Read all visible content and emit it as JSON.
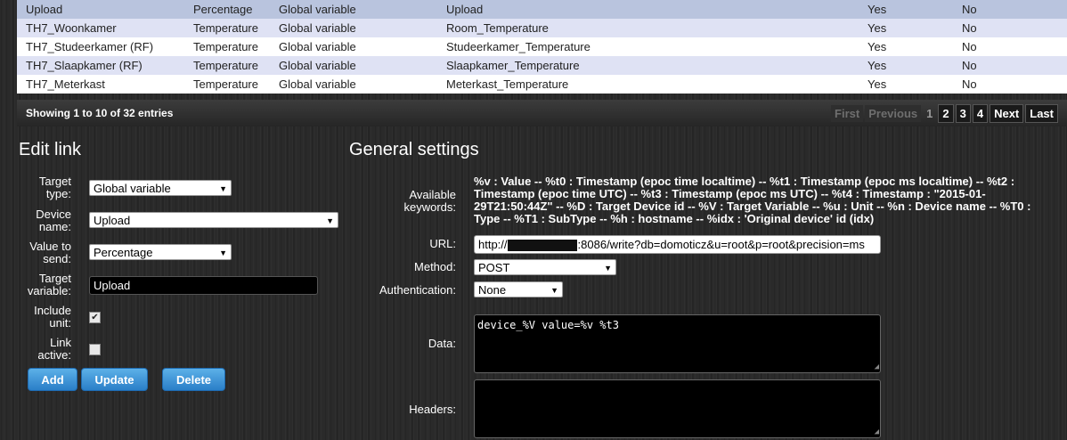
{
  "table": {
    "partial_row": [
      "",
      "",
      ""
    ],
    "rows": [
      {
        "name": "Upload",
        "type": "Percentage",
        "target": "Global variable",
        "variable": "Upload",
        "include_unit": "Yes",
        "active": "No",
        "style": "selected"
      },
      {
        "name": "TH7_Woonkamer",
        "type": "Temperature",
        "target": "Global variable",
        "variable": "Room_Temperature",
        "include_unit": "Yes",
        "active": "No",
        "style": "odd"
      },
      {
        "name": "TH7_Studeerkamer (RF)",
        "type": "Temperature",
        "target": "Global variable",
        "variable": "Studeerkamer_Temperature",
        "include_unit": "Yes",
        "active": "No",
        "style": "even"
      },
      {
        "name": "TH7_Slaapkamer (RF)",
        "type": "Temperature",
        "target": "Global variable",
        "variable": "Slaapkamer_Temperature",
        "include_unit": "Yes",
        "active": "No",
        "style": "odd"
      },
      {
        "name": "TH7_Meterkast",
        "type": "Temperature",
        "target": "Global variable",
        "variable": "Meterkast_Temperature",
        "include_unit": "Yes",
        "active": "No",
        "style": "even"
      }
    ],
    "info": "Showing 1 to 10 of 32 entries",
    "paging": {
      "first": "First",
      "previous": "Previous",
      "pages": [
        "1",
        "2",
        "3",
        "4"
      ],
      "next": "Next",
      "last": "Last",
      "current": "1"
    }
  },
  "edit_link": {
    "title": "Edit link",
    "target_type_label": "Target type:",
    "target_type_value": "Global variable",
    "device_name_label": "Device name:",
    "device_name_value": "Upload",
    "value_to_send_label": "Value to send:",
    "value_to_send_value": "Percentage",
    "target_variable_label": "Target variable:",
    "target_variable_value": "Upload",
    "include_unit_label": "Include unit:",
    "include_unit_checked": true,
    "link_active_label": "Link active:",
    "link_active_checked": false,
    "buttons": {
      "add": "Add",
      "update": "Update",
      "delete": "Delete"
    }
  },
  "general_settings": {
    "title": "General settings",
    "keywords_label": "Available keywords:",
    "keywords_text": "%v : Value -- %t0 : Timestamp (epoc time localtime) -- %t1 : Timestamp (epoc ms localtime) -- %t2 : Timestamp (epoc time UTC) -- %t3 : Timestamp (epoc ms UTC) -- %t4 : Timestamp : \"2015-01-29T21:50:44Z\" -- %D : Target Device id -- %V : Target Variable -- %u : Unit -- %n : Device name -- %T0 : Type -- %T1 : SubType -- %h : hostname -- %idx : 'Original device' id (idx)",
    "url_label": "URL:",
    "url_prefix": "http://",
    "url_suffix": ":8086/write?db=domoticz&u=root&p=root&precision=ms",
    "method_label": "Method:",
    "method_value": "POST",
    "auth_label": "Authentication:",
    "auth_value": "None",
    "data_label": "Data:",
    "data_value": "device_%V value=%v %t3",
    "headers_label": "Headers:",
    "headers_value": ""
  },
  "icons": {
    "dropdown": "chevron-down-icon",
    "check": "checkmark-icon",
    "resize": "resize-grip-icon"
  }
}
